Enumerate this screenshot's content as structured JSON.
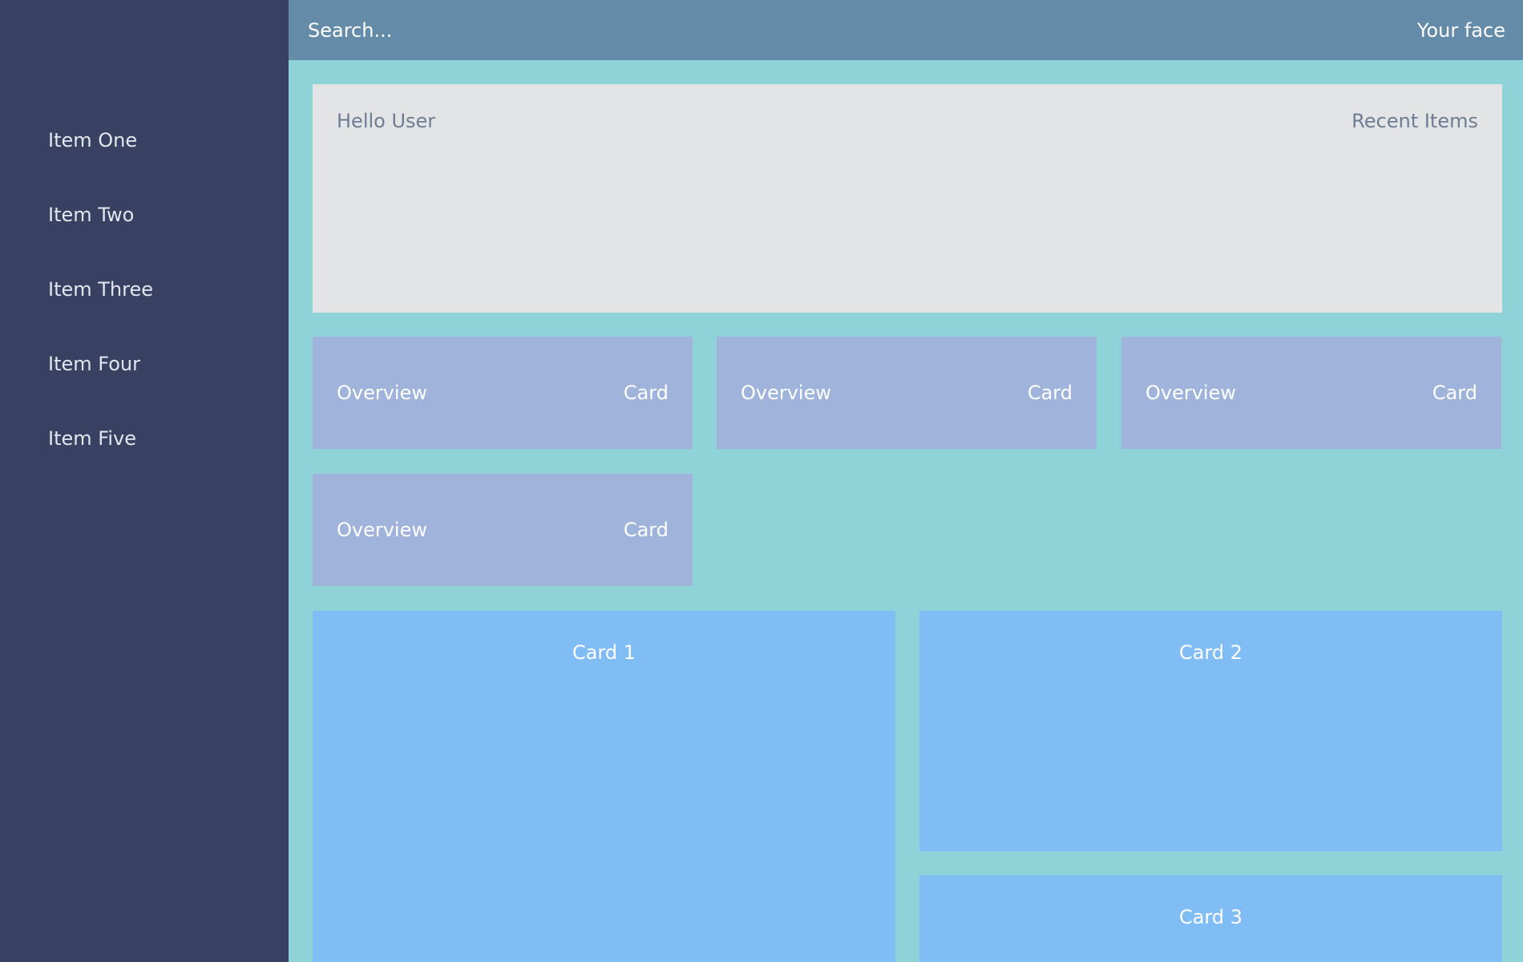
{
  "sidebar": {
    "items": [
      {
        "label": "Item One"
      },
      {
        "label": "Item Two"
      },
      {
        "label": "Item Three"
      },
      {
        "label": "Item Four"
      },
      {
        "label": "Item Five"
      }
    ]
  },
  "header": {
    "search_placeholder": "Search...",
    "user_label": "Your face"
  },
  "welcome": {
    "greeting": "Hello User",
    "recent_label": "Recent Items"
  },
  "overview_cards": [
    {
      "left": "Overview",
      "right": "Card"
    },
    {
      "left": "Overview",
      "right": "Card"
    },
    {
      "left": "Overview",
      "right": "Card"
    },
    {
      "left": "Overview",
      "right": "Card"
    }
  ],
  "cards": [
    {
      "title": "Card 1"
    },
    {
      "title": "Card 2"
    },
    {
      "title": "Card 3"
    }
  ],
  "colors": {
    "sidebar": "#394162",
    "header": "#648ca8",
    "background": "#8fd3d9",
    "welcome_panel": "#e3e4e6",
    "overview_card": "#9fb3db",
    "card": "#80bdf4"
  }
}
